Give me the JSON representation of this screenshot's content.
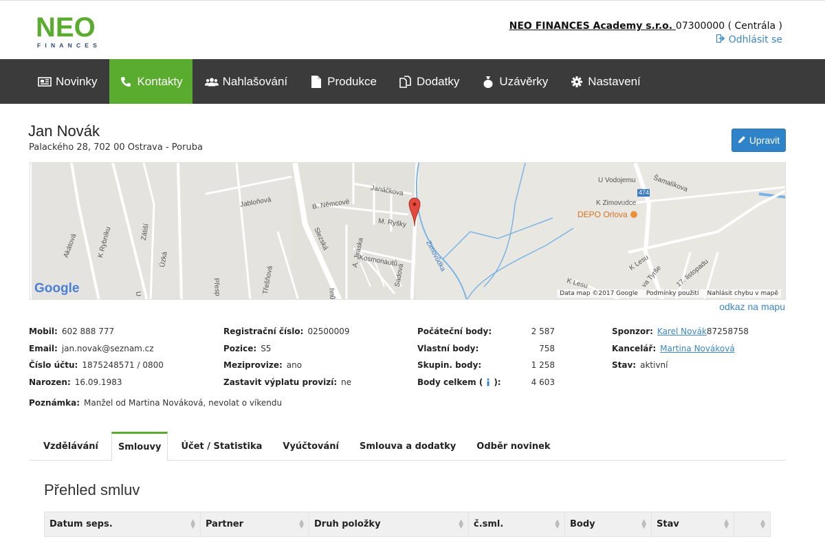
{
  "brand": {
    "logo_text": "NEO",
    "logo_sub": "FINANCES",
    "logo_color": "#5aac2e"
  },
  "header": {
    "company_name": "NEO FINANCES Academy s.r.o. ",
    "company_id": "07300000 ( Centrála )",
    "logout_label": "Odhlásit se",
    "logout_icon": "sign-out-icon"
  },
  "nav": {
    "items": [
      {
        "label": "Novinky",
        "icon": "newspaper-icon"
      },
      {
        "label": "Kontakty",
        "icon": "phone-icon",
        "active": true
      },
      {
        "label": "Nahlašování",
        "icon": "users-icon"
      },
      {
        "label": "Produkce",
        "icon": "file-icon"
      },
      {
        "label": "Dodatky",
        "icon": "copy-icon"
      },
      {
        "label": "Uzávěrky",
        "icon": "bag-icon"
      },
      {
        "label": "Nastavení",
        "icon": "cog-icon"
      }
    ],
    "active_color": "#5aac2e",
    "bg_color": "#3b3b3b"
  },
  "contact": {
    "name": "Jan Novák",
    "address": "Palackého 28, 702 00 Ostrava - Poruba",
    "edit_label": "Upravit"
  },
  "map": {
    "labels": {
      "u_vodojemu": "U Vodojemu",
      "samalikova": "Šamalíkova",
      "road_474": "474",
      "k_zimovudce": "K Zimovudce",
      "depo": "DEPO Orlova",
      "janackova": "Janáčkova",
      "jablonova": "Jabloňová",
      "b_nemcove": "B. Němcové",
      "m_rysky": "M. Ryšky",
      "zatisi": "Zátiší",
      "akatova": "Akátová",
      "k_rybniku": "K Rybníku",
      "uzka": "Úzká",
      "slezska": "Slezská",
      "jiraska": "A. Jiráska",
      "kosmonautu": "Kosmonautů",
      "sadova": "Sadová",
      "zimovudka": "Zimovůdka",
      "tresnova": "Třešňová",
      "k_lesu": "K Lesu",
      "k_lesu2": "K Lesu",
      "tyrse": "va Tyrše",
      "listopadu": "17. listopadu",
      "presp": "Přesp",
      "hnu": "hnů",
      "u": "U"
    },
    "google": "Google",
    "data_label": "Data map ©2017 Google",
    "terms_label": "Podmínky použití",
    "report_label": "Nahlásit chybu v mapě",
    "link_label": "odkaz na mapu"
  },
  "details": {
    "col1": [
      {
        "label": "Mobil:",
        "value": "602 888 777"
      },
      {
        "label": "Email:",
        "value": "jan.novak@seznam.cz"
      },
      {
        "label": "Číslo účtu:",
        "value": "1875248571 / 0800"
      },
      {
        "label": "Narozen:",
        "value": "16.09.1983"
      }
    ],
    "col2": [
      {
        "label": "Registrační číslo:",
        "value": "02500009"
      },
      {
        "label": "Pozice:",
        "value": "S5"
      },
      {
        "label": "Meziprovize:",
        "value": "ano"
      },
      {
        "label": "Zastavit výplatu provizí:",
        "value": "ne"
      }
    ],
    "col3": [
      {
        "label": "Počáteční body:",
        "value": "2 587"
      },
      {
        "label": "Vlastní body:",
        "value": "758"
      },
      {
        "label": "Skupin. body:",
        "value": "1 258"
      },
      {
        "label": "Body celkem (",
        "label_after": "):",
        "value": "4 603"
      }
    ],
    "col4": {
      "sponsor_label": "Sponzor:",
      "sponsor_link": "Karel Novák ",
      "sponsor_id": "87258758",
      "office_label": "Kancelář:",
      "office_link": "Martina Nováková",
      "status_label": "Stav:",
      "status_value": "aktivní"
    },
    "note_label": "Poznámka:",
    "note_value": "Manžel od Martina Nováková, nevolat o víkendu"
  },
  "tabs": [
    {
      "label": "Vzdělávání"
    },
    {
      "label": "Smlouvy",
      "active": true
    },
    {
      "label": "Účet / Statistika"
    },
    {
      "label": "Vyúčtování"
    },
    {
      "label": "Smlouva a dodatky"
    },
    {
      "label": "Odběr novinek"
    }
  ],
  "contracts": {
    "title": "Přehled smluv",
    "columns": [
      "Datum seps.",
      "Partner",
      "Druh položky",
      "č.sml.",
      "Body",
      "Stav",
      ""
    ]
  }
}
